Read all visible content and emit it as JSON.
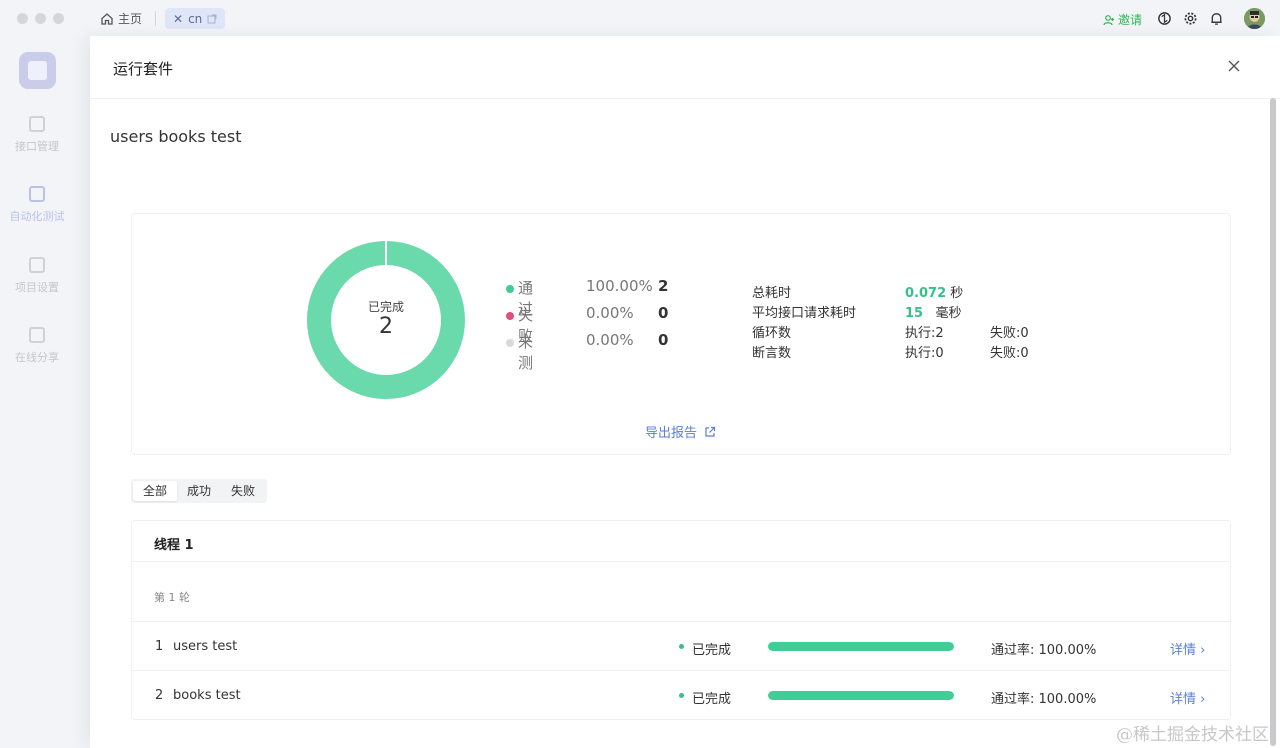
{
  "titlebar": {
    "home_tab": "主页",
    "project_tab": "cn",
    "invite": "邀请"
  },
  "sidebar": {
    "items": [
      {
        "label": "接口管理"
      },
      {
        "label": "自动化测试"
      },
      {
        "label": "项目设置"
      },
      {
        "label": "在线分享"
      }
    ]
  },
  "drawer": {
    "title": "运行套件",
    "suite_name": "users books test"
  },
  "summary": {
    "donut_label": "已完成",
    "donut_count": "2",
    "legend": [
      {
        "name": "通过",
        "percent": "100.00%",
        "count": "2",
        "color": "#3ccf91"
      },
      {
        "name": "失败",
        "percent": "0.00%",
        "count": "0",
        "color": "#e0507a"
      },
      {
        "name": "未测",
        "percent": "0.00%",
        "count": "0",
        "color": "#d9d9d9"
      }
    ],
    "stats": {
      "total_time_label": "总耗时",
      "total_time_value": "0.072",
      "total_time_unit": "秒",
      "avg_time_label": "平均接口请求耗时",
      "avg_time_value": "15",
      "avg_time_unit": "毫秒",
      "loop_label": "循环数",
      "loop_exec": "执行:2",
      "loop_fail": "失败:0",
      "assert_label": "断言数",
      "assert_exec": "执行:0",
      "assert_fail": "失败:0"
    },
    "export": "导出报告"
  },
  "filters": {
    "tabs": [
      {
        "label": "全部",
        "active": true
      },
      {
        "label": "成功",
        "active": false
      },
      {
        "label": "失败",
        "active": false
      }
    ]
  },
  "thread": {
    "title": "线程 1",
    "round": "第 1 轮",
    "cases": [
      {
        "index": "1",
        "name": "users test",
        "status": "已完成",
        "progress": 1.0,
        "rate": "通过率: 100.00%",
        "detail": "详情 ›"
      },
      {
        "index": "2",
        "name": "books test",
        "status": "已完成",
        "progress": 1.0,
        "rate": "通过率: 100.00%",
        "detail": "详情 ›"
      }
    ]
  },
  "watermark": "@稀土掘金技术社区"
}
